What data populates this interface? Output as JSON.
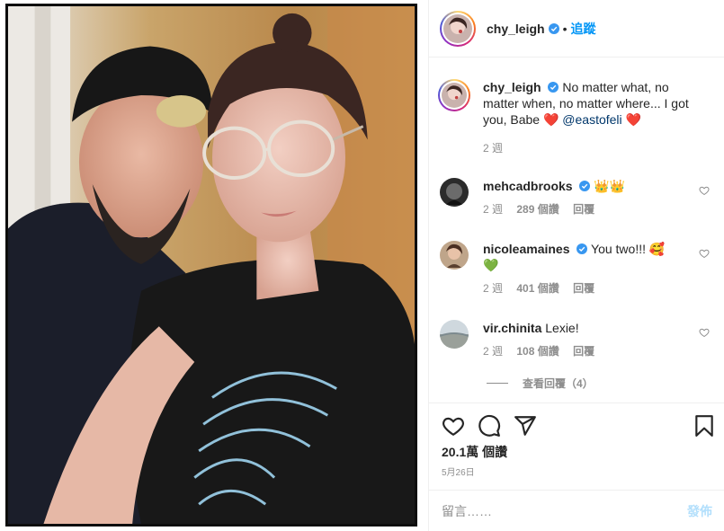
{
  "post": {
    "image_alt": "Selfie of a couple",
    "author": {
      "username": "chy_leigh",
      "verified": true,
      "follow_label": "追蹤",
      "separator": "•"
    },
    "caption": {
      "username": "chy_leigh",
      "text": "No matter what, no matter when, no matter where... I got you, Babe",
      "heart": "❤️",
      "mention": "@eastofeli",
      "time": "2 週"
    },
    "comments": [
      {
        "username": "mehcadbrooks",
        "verified": true,
        "text": "👑👑",
        "time": "2 週",
        "likes": "289 個讚",
        "reply": "回覆"
      },
      {
        "username": "nicoleamaines",
        "verified": true,
        "text": "You two!!! 🥰",
        "text2": "💚",
        "time": "2 週",
        "likes": "401 個讚",
        "reply": "回覆"
      },
      {
        "username": "vir.chinita",
        "verified": false,
        "text": "Lexie!",
        "time": "2 週",
        "likes": "108 個讚",
        "reply": "回覆"
      }
    ],
    "view_replies": "查看回覆（4）",
    "likes": "20.1萬 個讚",
    "date": "5月26日",
    "comment_input": {
      "placeholder": "留言……",
      "post_label": "發佈"
    },
    "colors": {
      "accent": "#0095f6",
      "heart": "#ed4956",
      "muted": "#8e8e8e"
    },
    "icons": [
      "heart-icon",
      "comment-icon",
      "share-icon",
      "bookmark-icon"
    ]
  }
}
